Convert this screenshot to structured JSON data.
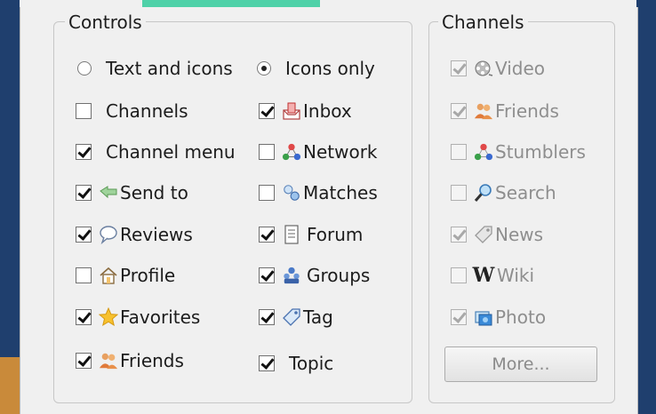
{
  "controls": {
    "title": "Controls",
    "display_mode": [
      {
        "label": "Text and icons",
        "selected": false
      },
      {
        "label": "Icons only",
        "selected": true
      }
    ],
    "left_items": [
      {
        "label": "Channels",
        "checked": false,
        "icon": "none"
      },
      {
        "label": "Channel menu",
        "checked": true,
        "icon": "none"
      },
      {
        "label": "Send to",
        "checked": true,
        "icon": "send-to-icon"
      },
      {
        "label": "Reviews",
        "checked": true,
        "icon": "speech-bubble-icon"
      },
      {
        "label": "Profile",
        "checked": false,
        "icon": "house-icon"
      },
      {
        "label": "Favorites",
        "checked": true,
        "icon": "star-icon"
      },
      {
        "label": "Friends",
        "checked": true,
        "icon": "people-icon"
      }
    ],
    "right_items": [
      {
        "label": "Inbox",
        "checked": true,
        "icon": "inbox-icon"
      },
      {
        "label": "Network",
        "checked": false,
        "icon": "network-icon"
      },
      {
        "label": "Matches",
        "checked": false,
        "icon": "matches-icon"
      },
      {
        "label": "Forum",
        "checked": true,
        "icon": "document-icon"
      },
      {
        "label": "Groups",
        "checked": true,
        "icon": "groups-icon"
      },
      {
        "label": "Tag",
        "checked": true,
        "icon": "tag-icon"
      },
      {
        "label": "Topic",
        "checked": true,
        "icon": "none"
      }
    ]
  },
  "channels": {
    "title": "Channels",
    "items": [
      {
        "label": "Video",
        "checked": true,
        "icon": "film-reel-icon"
      },
      {
        "label": "Friends",
        "checked": true,
        "icon": "people-icon"
      },
      {
        "label": "Stumblers",
        "checked": false,
        "icon": "network-icon"
      },
      {
        "label": "Search",
        "checked": false,
        "icon": "magnifier-icon"
      },
      {
        "label": "News",
        "checked": true,
        "icon": "news-tag-icon"
      },
      {
        "label": "Wiki",
        "checked": false,
        "icon": "wiki-w-icon"
      },
      {
        "label": "Photo",
        "checked": true,
        "icon": "photo-icon"
      }
    ],
    "more_button": "More..."
  },
  "colors": {
    "background": "#f0f0f0",
    "border": "#c7c7c7",
    "text": "#1c1c1c",
    "disabled_text": "#8e8e8e"
  }
}
